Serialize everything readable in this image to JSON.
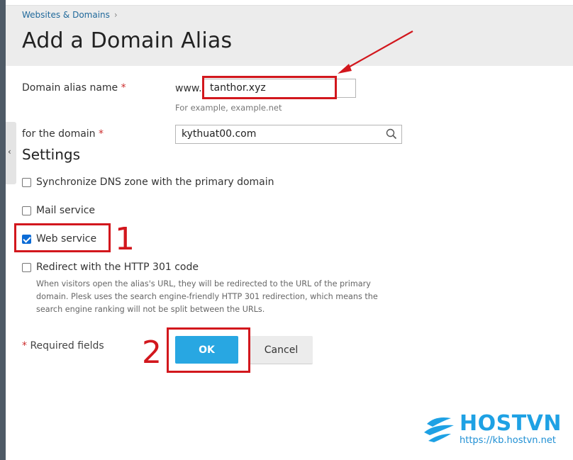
{
  "header": {
    "breadcrumb": "Websites & Domains",
    "breadcrumb_sep": "›",
    "title": "Add a Domain Alias"
  },
  "form": {
    "alias_label": "Domain alias name",
    "required_mark": "*",
    "www_prefix": "www.",
    "alias_value": "tanthor.xyz",
    "alias_hint": "For example, example.net",
    "domain_label": "for the domain",
    "domain_value": "kythuat00.com"
  },
  "settings": {
    "title": "Settings",
    "options": [
      {
        "label": "Synchronize DNS zone with the primary domain",
        "checked": false
      },
      {
        "label": "Mail service",
        "checked": false
      },
      {
        "label": "Web service",
        "checked": true
      },
      {
        "label": "Redirect with the HTTP 301 code",
        "checked": false
      }
    ],
    "redirect_desc": "When visitors open the alias's URL, they will be redirected to the URL of the primary domain. Plesk uses the search engine-friendly HTTP 301 redirection, which means the search engine ranking will not be split between the URLs."
  },
  "footer": {
    "required_fields": "Required fields",
    "ok_label": "OK",
    "cancel_label": "Cancel"
  },
  "annotations": {
    "step1": "1",
    "step2": "2",
    "color": "#d2171d"
  },
  "watermark": {
    "brand": "HOSTVN",
    "url": "https://kb.hostvn.net"
  },
  "colors": {
    "primary_button": "#28a7e2",
    "link": "#20699b",
    "checkbox_checked": "#0b6bd6"
  }
}
